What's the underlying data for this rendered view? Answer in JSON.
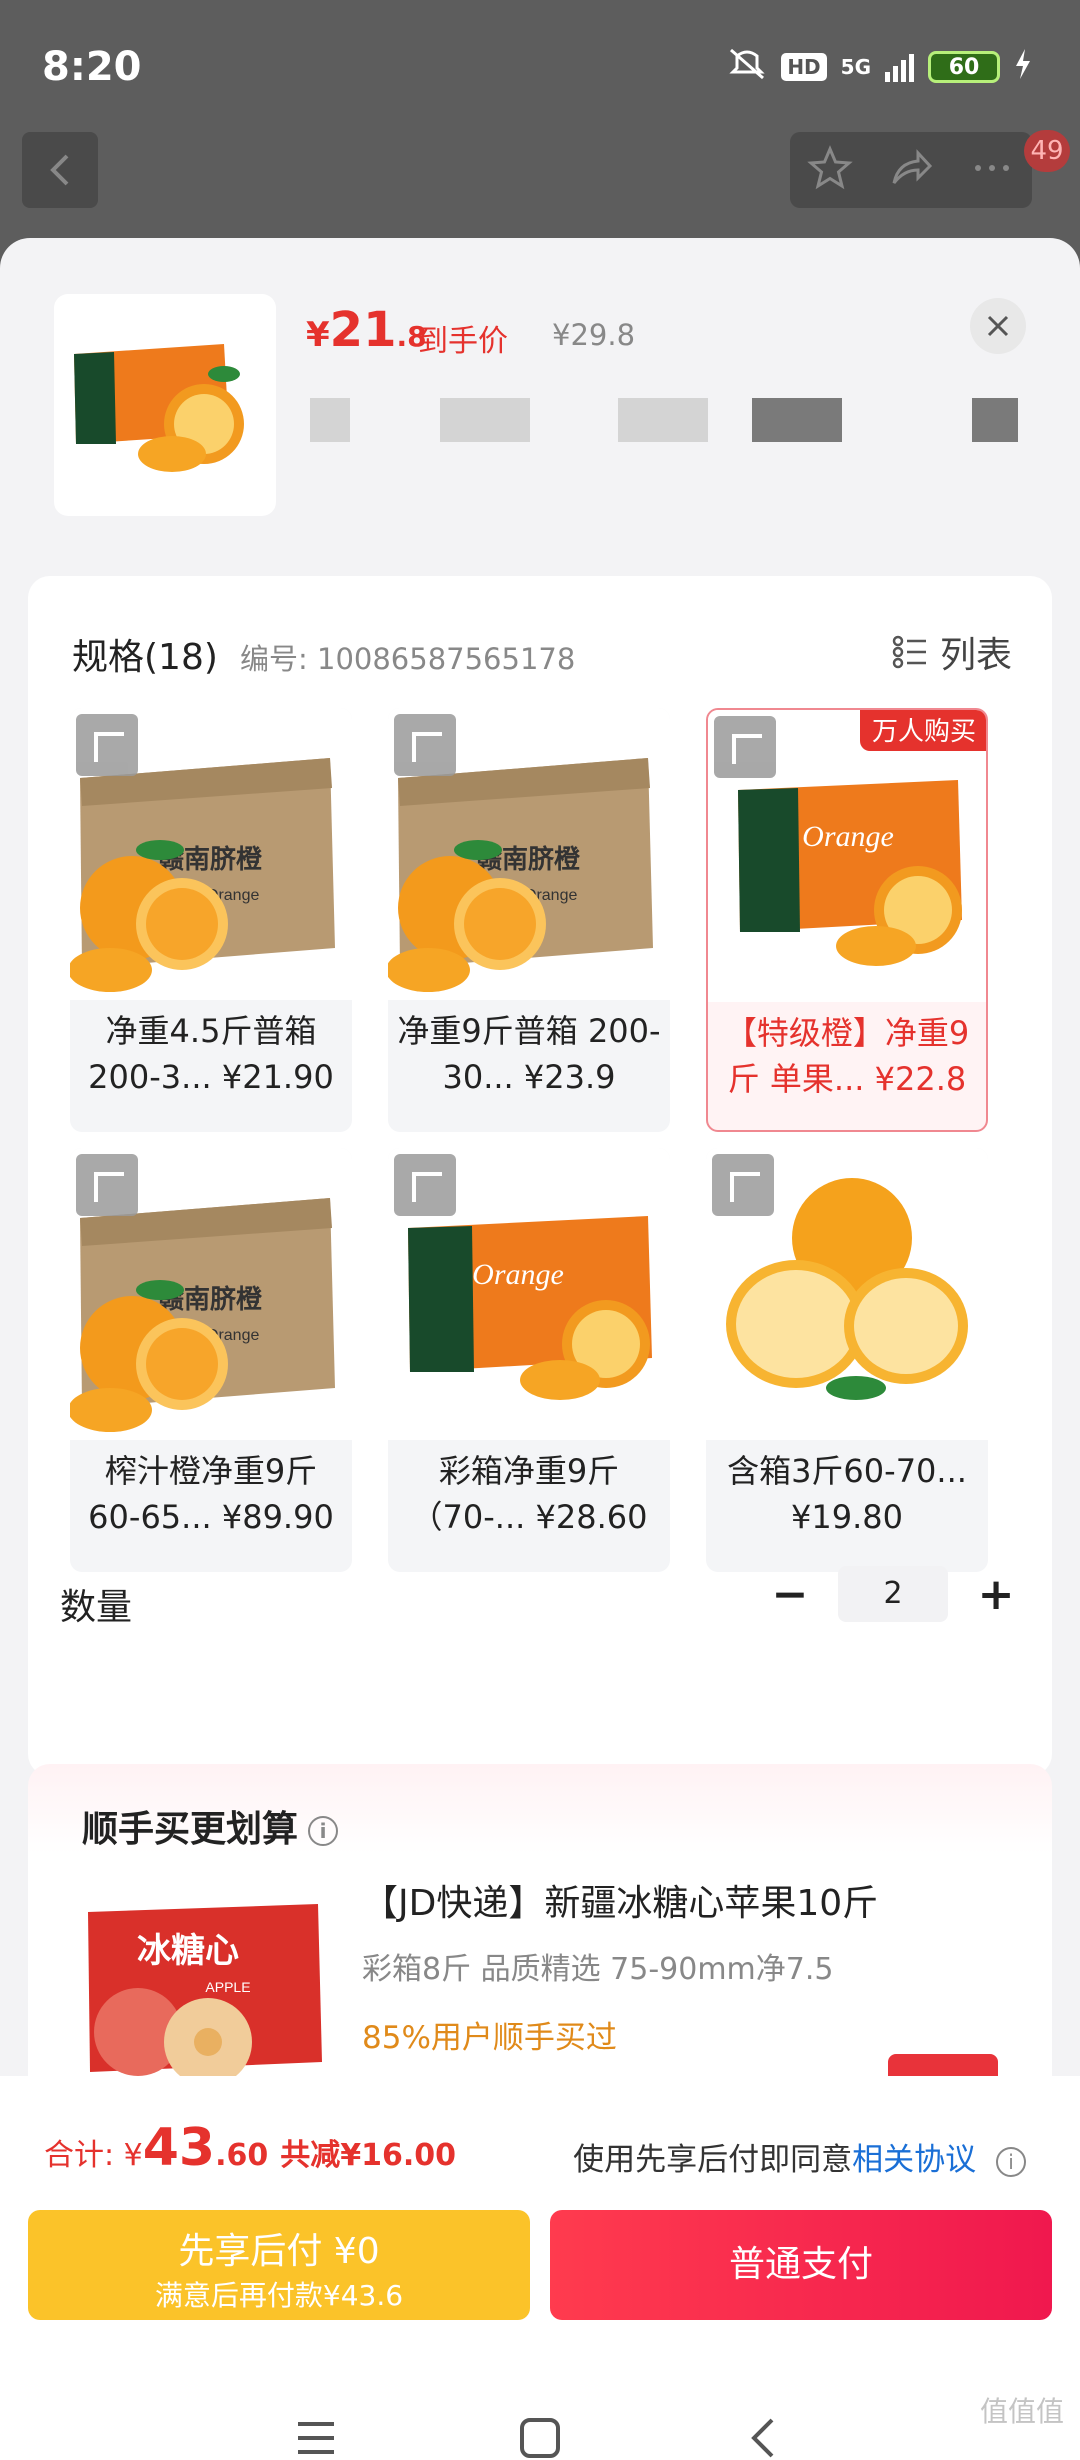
{
  "status": {
    "time": "8:20",
    "hd": "HD",
    "network": "5G",
    "battery": "60"
  },
  "nav": {
    "badge": "49"
  },
  "product": {
    "price_symbol": "¥",
    "price_int": "21",
    "price_dec": ".8",
    "price_label": "到手价",
    "original_price": "¥29.8"
  },
  "spec": {
    "title": "规格(18)",
    "code": "编号: 10086587565178",
    "list_label": "列表"
  },
  "variants": [
    {
      "label": "净重4.5斤普箱 200-3... ¥21.90"
    },
    {
      "label": "净重9斤普箱 200-30... ¥23.9"
    },
    {
      "label": "【特级橙】净重9斤 单果... ¥22.8",
      "tag": "万人购买"
    },
    {
      "label": "榨汁橙净重9斤 60-65... ¥89.90"
    },
    {
      "label": "彩箱净重9斤 （70-... ¥28.60"
    },
    {
      "label": "含箱3斤60-70... ¥19.80"
    }
  ],
  "box_text": {
    "cn": "赣南脐橙",
    "en": "Navel Orange",
    "en2": "Orange"
  },
  "quantity": {
    "label": "数量",
    "minus": "−",
    "value": "2",
    "plus": "+"
  },
  "bundle": {
    "title": "顺手买更划算",
    "info_icon": "i",
    "item_name": "【JD快递】新疆冰糖心苹果10斤",
    "item_sub": "彩箱8斤 品质精选 75-90mm净7.5",
    "item_note": "85%用户顺手买过",
    "box_cn": "冰糖心",
    "box_en": "APPLE"
  },
  "footer": {
    "total_label": "合计: ¥",
    "total_int": "43",
    "total_dec": ".60",
    "discount": "共减¥16.00",
    "agree_prefix": "使用先享后付即同意",
    "agree_link": "相关协议",
    "btn_later_title": "先享后付 ¥0",
    "btn_later_sub": "满意后再付款¥43.6",
    "btn_pay": "普通支付"
  },
  "watermark": "值值值"
}
